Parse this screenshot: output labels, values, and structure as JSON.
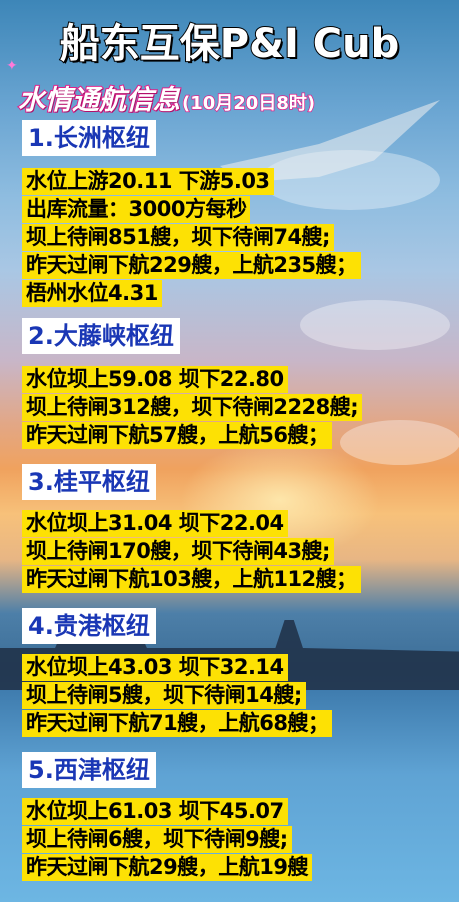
{
  "title": "船东互保P&I Cub",
  "subtitle": {
    "main": "水情通航信息",
    "date": "(10月20日8时)"
  },
  "sections": [
    {
      "heading": "1.长洲枢纽",
      "lines": [
        "水位上游20.11  下游5.03",
        "出库流量：3000方每秒",
        "坝上待闸851艘，坝下待闸74艘;",
        "昨天过闸下航229艘，上航235艘；",
        "梧州水位4.31"
      ]
    },
    {
      "heading": "2.大藤峡枢纽",
      "lines": [
        "水位坝上59.08   坝下22.80",
        "坝上待闸312艘，坝下待闸2228艘;",
        "昨天过闸下航57艘，上航56艘；"
      ]
    },
    {
      "heading": "3.桂平枢纽",
      "lines": [
        "水位坝上31.04   坝下22.04",
        "坝上待闸170艘，坝下待闸43艘;",
        "昨天过闸下航103艘，上航112艘；"
      ]
    },
    {
      "heading": "4.贵港枢纽",
      "lines": [
        "水位坝上43.03   坝下32.14",
        "坝上待闸5艘，坝下待闸14艘;",
        "昨天过闸下航71艘，上航68艘；"
      ]
    },
    {
      "heading": "5.西津枢纽",
      "lines": [
        "水位坝上61.03   坝下45.07",
        "坝上待闸6艘，坝下待闸9艘;",
        "昨天过闸下航29艘，上航19艘"
      ]
    }
  ]
}
